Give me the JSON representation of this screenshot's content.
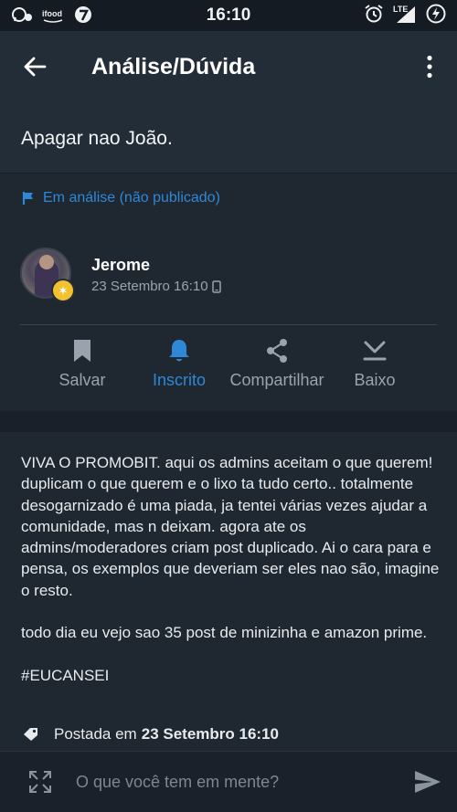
{
  "status_bar": {
    "time": "16:10",
    "lte": "LTE",
    "apps": [
      "whatsapp-icon",
      "ifood-icon",
      "kanguru-icon"
    ]
  },
  "app_bar": {
    "title": "Análise/Dúvida"
  },
  "post": {
    "title": "Apagar nao João.",
    "status": "Em análise (não publicado)",
    "author": {
      "name": "Jerome",
      "date": "23 Setembro 16:10"
    },
    "body": "VIVA O PROMOBIT. aqui os admins aceitam o que querem! duplicam o que querem e o lixo ta tudo certo.. totalmente desogarnizado é uma piada, ja tentei várias vezes ajudar a comunidade, mas n deixam. agora ate os admins/moderadores criam post duplicado. Ai o cara para e pensa, os exemplos que deveriam ser eles nao são, imagine o resto.\n\ntodo dia eu vejo sao 35 post de minizinha e amazon prime.\n\n#EUCANSEI",
    "posted_prefix": "Postada em",
    "posted_date": "23 Setembro 16:10"
  },
  "actions": {
    "save": "Salvar",
    "subscribed": "Inscrito",
    "share": "Compartilhar",
    "download": "Baixo"
  },
  "composer": {
    "placeholder": "O que você tem em mente?"
  },
  "colors": {
    "accent": "#2f88d6",
    "background": "#1f2731",
    "badge": "#f2c12e"
  }
}
